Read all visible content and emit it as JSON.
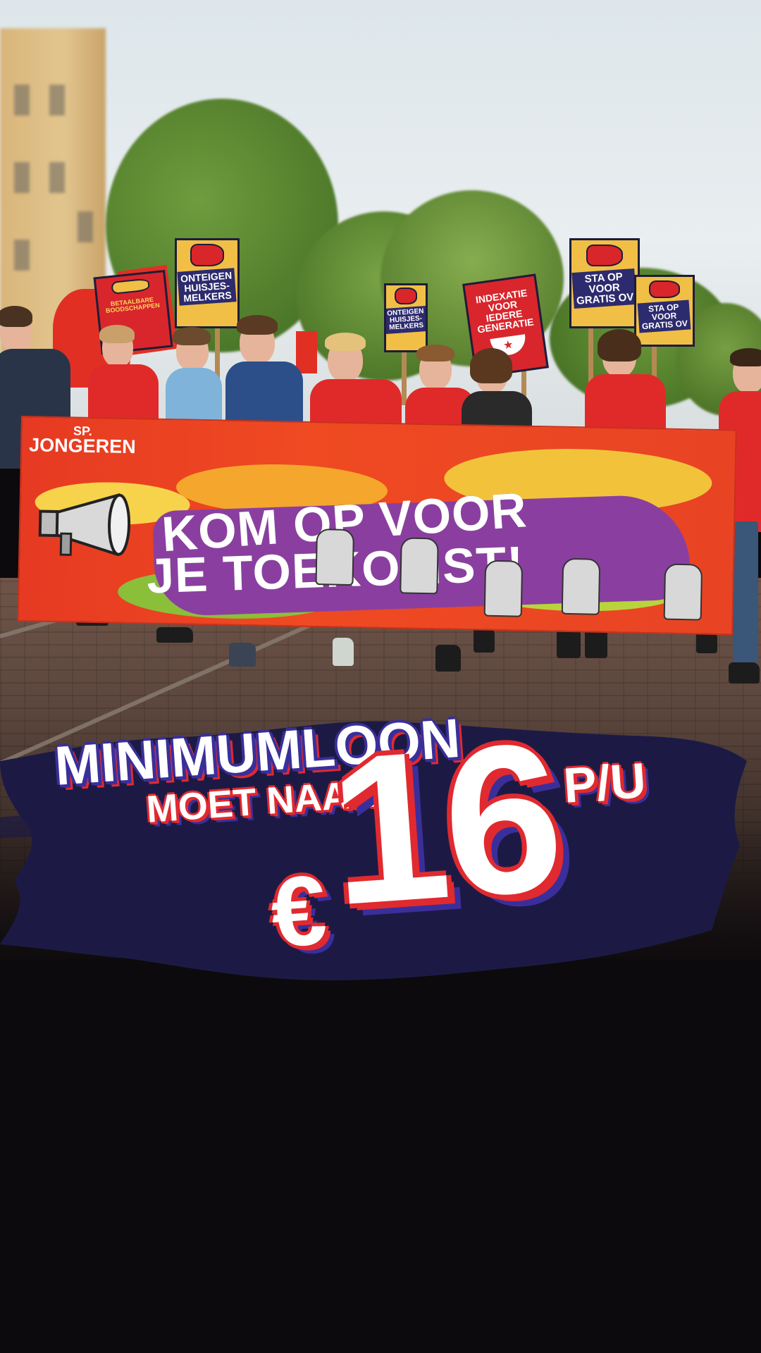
{
  "photo": {
    "banner": {
      "logo_top": "SP.",
      "logo_name": "JONGEREN",
      "line1": "KOM OP VOOR",
      "line2": "JE TOEKOMST!"
    },
    "signs": [
      {
        "text": "ONTEIGEN\nHUISJES-\nMELKERS"
      },
      {
        "text": "BETAALBARE\nBOODSCHAPPEN"
      },
      {
        "text": "ONTEIGEN\nHUISJES-\nMELKERS"
      },
      {
        "text": "INDEXATIE\nVOOR\nIEDERE\nGENERATIE"
      },
      {
        "text": "STA OP\nVOOR\nGRATIS OV"
      },
      {
        "text": "STA OP\nVOOR\nGRATIS OV"
      }
    ]
  },
  "headline": {
    "line1": "MINIMUMLOON",
    "line2": "MOET NAAR",
    "currency": "€",
    "value": "16",
    "unit": "P/U"
  },
  "colors": {
    "brand_red": "#e02a2f",
    "brand_navy": "#1c1a45",
    "brand_blue": "#3a2f9a",
    "banner_purple": "#8a3fa0",
    "background_dark": "#0c0a0c"
  },
  "icons": [
    "megaphone-icon",
    "raised-fist-icon",
    "star-icon"
  ]
}
